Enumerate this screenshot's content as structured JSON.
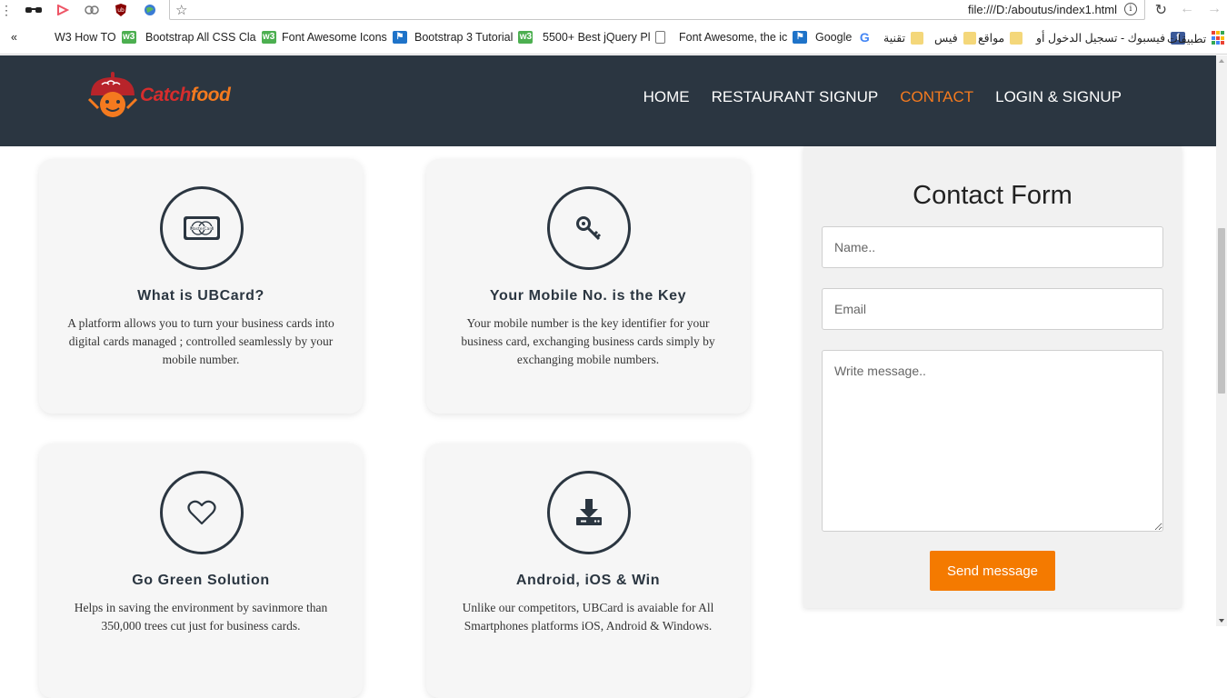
{
  "browser": {
    "url": "file:///D:/aboutus/index1.html",
    "bookmarks": [
      {
        "label": "W3 How TO",
        "icon": "w3-icon"
      },
      {
        "label": "Bootstrap All CSS Cla",
        "icon": "w3-icon"
      },
      {
        "label": "Font Awesome Icons",
        "icon": "w3-icon"
      },
      {
        "label": "Bootstrap 3 Tutorial",
        "icon": "flag-icon"
      },
      {
        "label": "5500+ Best jQuery Pl",
        "icon": "w3-icon"
      },
      {
        "label": "Font Awesome, the ic",
        "icon": "page-icon"
      },
      {
        "label": "Google",
        "icon": "flag-icon"
      },
      {
        "label": "تقنية",
        "icon": "google-icon"
      },
      {
        "label": "فيس",
        "icon": "folder-icon"
      },
      {
        "label": "مواقع",
        "icon": "folder-icon"
      },
      {
        "label": "فيسبوك - تسجيل الدخول أو",
        "icon": "folder-icon"
      },
      {
        "label": "تطبيقات",
        "icon": "facebook-icon"
      }
    ]
  },
  "header": {
    "logo_part1": "Catch",
    "logo_part2": "food",
    "nav": [
      {
        "label": "HOME",
        "active": false
      },
      {
        "label": "RESTAURANT SIGNUP",
        "active": false
      },
      {
        "label": "CONTACT",
        "active": true
      },
      {
        "label": "LOGIN & SIGNUP",
        "active": false
      }
    ]
  },
  "cards": [
    {
      "icon": "mastercard-icon",
      "title": "What is UBCard?",
      "desc": "A platform allows you to turn your business cards into digital cards managed ; controlled seamlessly by your mobile number."
    },
    {
      "icon": "key-icon",
      "title": "Your Mobile No. is the Key",
      "desc": "Your mobile number is the key identifier for your business card, exchanging business cards simply by exchanging mobile numbers."
    },
    {
      "icon": "heart-icon",
      "title": "Go Green Solution",
      "desc": "Helps in saving the environment by savinmore than 350,000 trees cut just for business cards."
    },
    {
      "icon": "download-icon",
      "title": "Android, iOS & Win",
      "desc": "Unlike our competitors, UBCard is avaiable for All Smartphones platforms iOS, Android & Windows."
    }
  ],
  "contact": {
    "title": "Contact Form",
    "name_placeholder": "Name..",
    "email_placeholder": "Email",
    "message_placeholder": "Write message..",
    "send_label": "Send message"
  },
  "colors": {
    "header_bg": "#2b3641",
    "accent": "#f47a1f",
    "button": "#f47a00",
    "card_bg": "#f6f6f6"
  }
}
